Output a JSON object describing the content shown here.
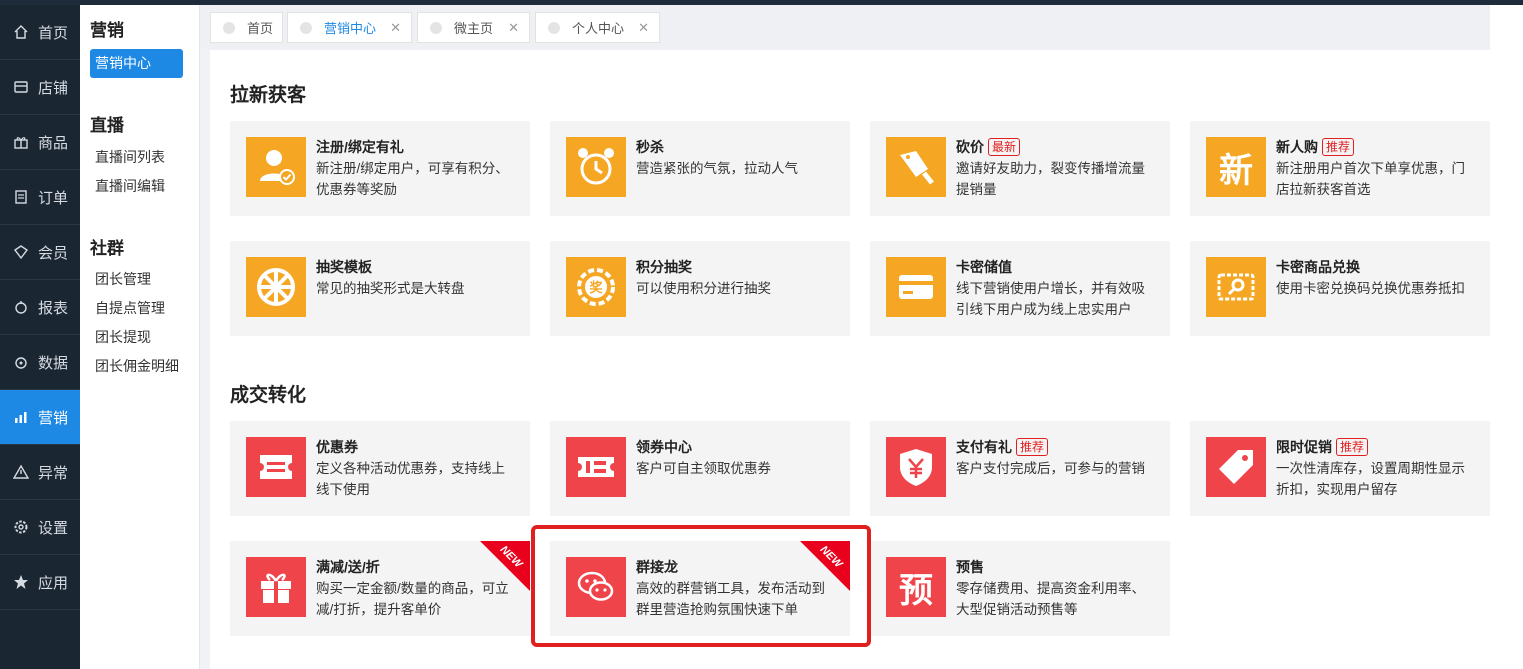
{
  "nav": {
    "items": [
      {
        "label": "首页",
        "icon": "home-icon"
      },
      {
        "label": "店铺",
        "icon": "store-icon"
      },
      {
        "label": "商品",
        "icon": "gift-icon"
      },
      {
        "label": "订单",
        "icon": "order-icon"
      },
      {
        "label": "会员",
        "icon": "member-icon"
      },
      {
        "label": "报表",
        "icon": "report-icon"
      },
      {
        "label": "数据",
        "icon": "data-icon"
      },
      {
        "label": "营销",
        "icon": "chart-icon",
        "active": true
      },
      {
        "label": "异常",
        "icon": "warning-icon"
      },
      {
        "label": "设置",
        "icon": "settings-icon"
      },
      {
        "label": "应用",
        "icon": "star-icon"
      }
    ]
  },
  "subnav": {
    "group1_title": "营销",
    "group1_items": [
      "营销中心"
    ],
    "group2_title": "直播",
    "group2_items": [
      "直播间列表",
      "直播间编辑"
    ],
    "group3_title": "社群",
    "group3_items": [
      "团长管理",
      "自提点管理",
      "团长提现",
      "团长佣金明细"
    ]
  },
  "tabs": [
    {
      "label": "首页",
      "closable": false
    },
    {
      "label": "营销中心",
      "closable": true,
      "active": true
    },
    {
      "label": "微主页",
      "closable": true
    },
    {
      "label": "个人中心",
      "closable": true
    }
  ],
  "sections": [
    {
      "title": "拉新获客",
      "cards": [
        {
          "title": "注册/绑定有礼",
          "badge": "",
          "desc": "新注册/绑定用户，可享有积分、优惠券等奖励",
          "icon": "user-check-icon",
          "color": "#f5a623"
        },
        {
          "title": "秒杀",
          "badge": "",
          "desc": "营造紧张的气氛，拉动人气",
          "icon": "alarm-clock-icon",
          "color": "#f5a623"
        },
        {
          "title": "砍价",
          "badge": "最新",
          "desc": "邀请好友助力，裂变传播增流量提销量",
          "icon": "cleaver-icon",
          "color": "#f5a623"
        },
        {
          "title": "新人购",
          "badge": "推荐",
          "desc": "新注册用户首次下单享优惠，门店拉新获客首选",
          "icon": "new-char-icon",
          "color": "#f5a623"
        },
        {
          "title": "抽奖模板",
          "badge": "",
          "desc": "常见的抽奖形式是大转盘",
          "icon": "wheel-icon",
          "color": "#f5a623"
        },
        {
          "title": "积分抽奖",
          "badge": "",
          "desc": "可以使用积分进行抽奖",
          "icon": "prize-wheel-icon",
          "color": "#f5a623"
        },
        {
          "title": "卡密储值",
          "badge": "",
          "desc": "线下营销使用户增长，并有效吸引线下用户成为线上忠实用户",
          "icon": "card-icon",
          "color": "#f5a623"
        },
        {
          "title": "卡密商品兑换",
          "badge": "",
          "desc": "使用卡密兑换码兑换优惠券抵扣",
          "icon": "ticket-search-icon",
          "color": "#f5a623"
        }
      ]
    },
    {
      "title": "成交转化",
      "cards": [
        {
          "title": "优惠券",
          "badge": "",
          "desc": "定义各种活动优惠券，支持线上线下使用",
          "icon": "coupon-icon",
          "color": "#f0444b"
        },
        {
          "title": "领券中心",
          "badge": "",
          "desc": "客户可自主领取优惠券",
          "icon": "ticket-center-icon",
          "color": "#f0444b"
        },
        {
          "title": "支付有礼",
          "badge": "推荐",
          "desc": "客户支付完成后，可参与的营销",
          "icon": "yen-shield-icon",
          "color": "#f0444b"
        },
        {
          "title": "限时促销",
          "badge": "推荐",
          "desc": "一次性清库存，设置周期性显示折扣，实现用户留存",
          "icon": "price-tag-icon",
          "color": "#f0444b"
        },
        {
          "title": "满减/送/折",
          "badge": "",
          "desc": "购买一定金额/数量的商品，可立减/打折，提升客单价",
          "icon": "gift-box-icon",
          "color": "#f0444b",
          "ribbon": "NEW"
        },
        {
          "title": "群接龙",
          "badge": "",
          "desc": "高效的群营销工具，发布活动到群里营造抢购氛围快速下单",
          "icon": "wechat-icon",
          "color": "#f0444b",
          "ribbon": "NEW",
          "highlighted": true
        },
        {
          "title": "预售",
          "badge": "",
          "desc": "零存储费用、提高资金利用率、大型促销活动预售等",
          "icon": "presale-char-icon",
          "color": "#f0444b"
        }
      ]
    }
  ],
  "icon_glyphs": {
    "new_char": "新",
    "presale_char": "预",
    "prize_char": "奖"
  }
}
